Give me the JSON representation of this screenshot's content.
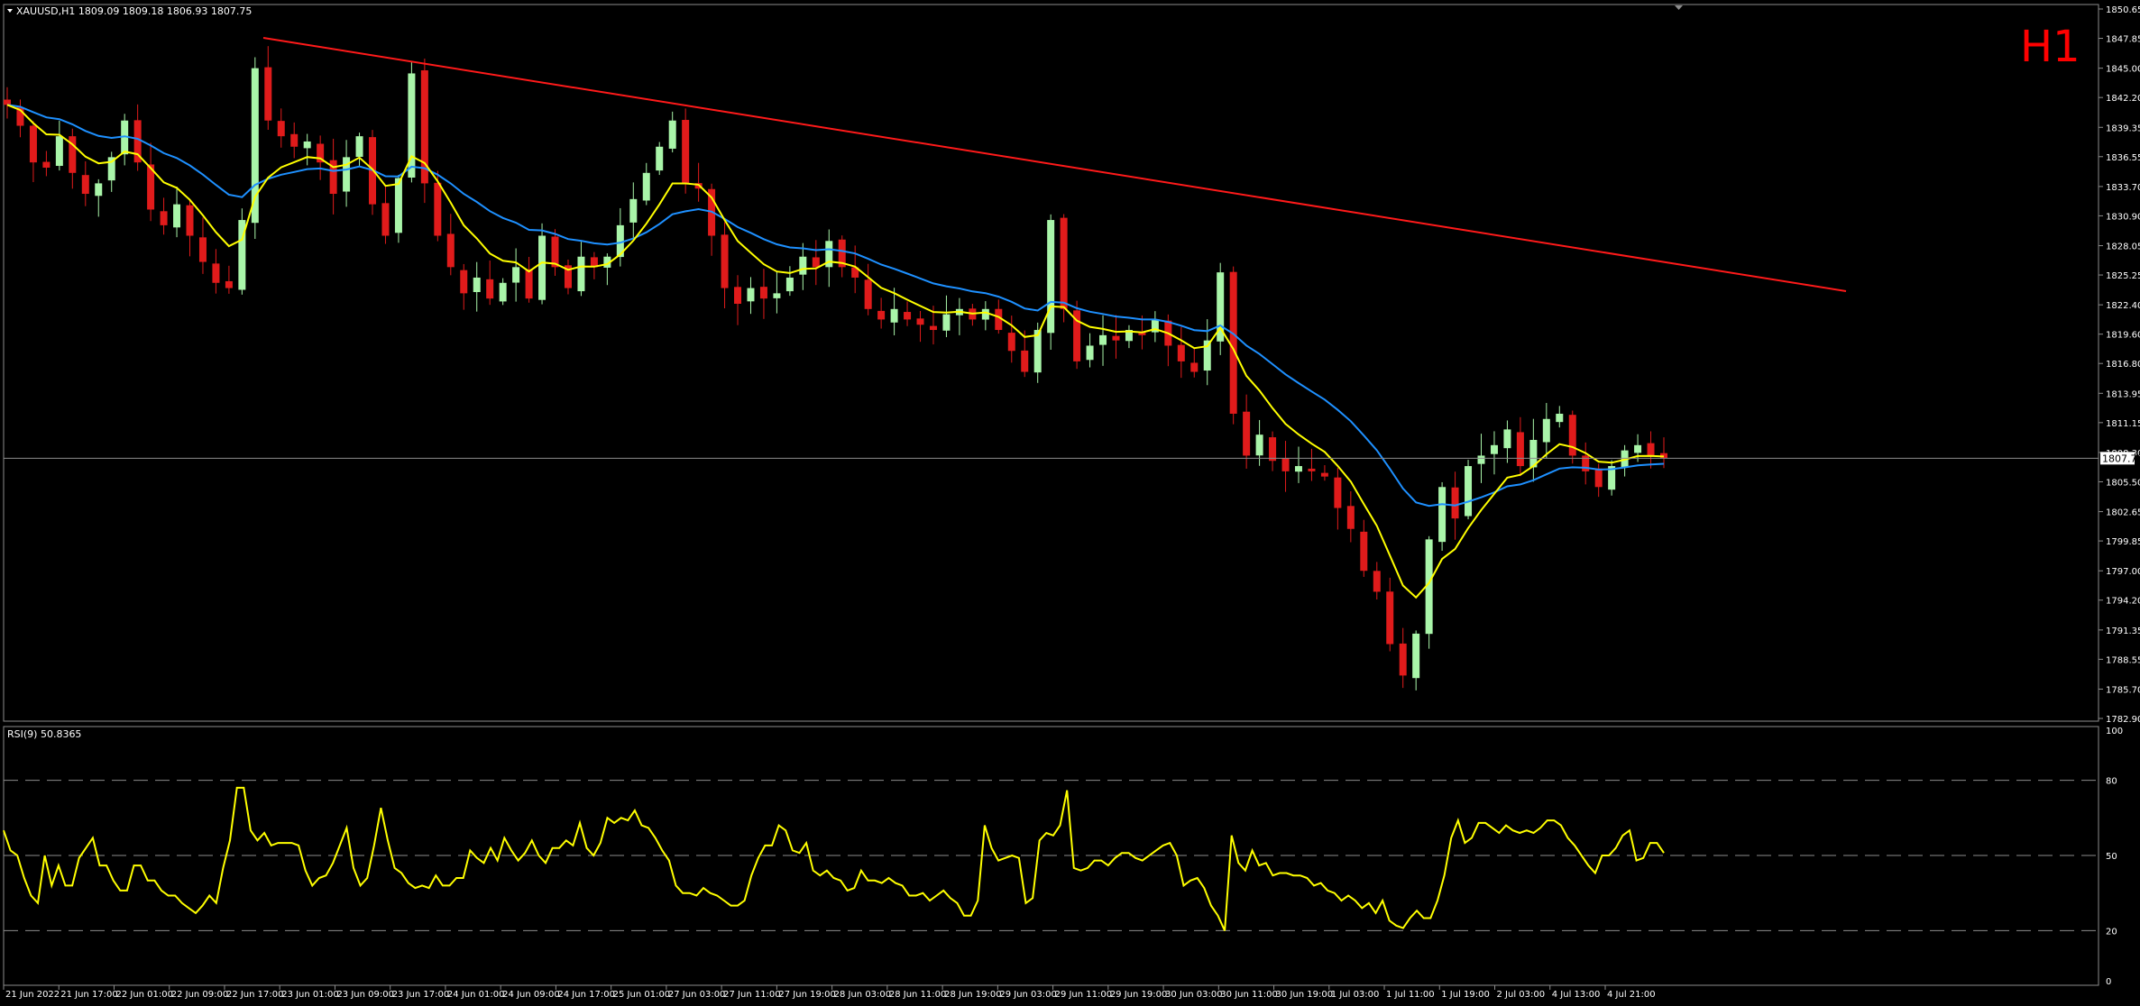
{
  "main": {
    "symbol_info": "XAUUSD,H1  1809.09 1809.18 1806.93 1807.75",
    "timeframe": "H1",
    "current_price": "1807.75",
    "current_price_value": 1807.75
  },
  "rsi": {
    "label": "RSI(9) 50.8365",
    "levels": [
      80,
      50,
      20
    ],
    "ticks": [
      "100",
      "80",
      "50",
      "20",
      "0"
    ]
  },
  "colors": {
    "background": "#000000",
    "bull": "#a9f5a9",
    "bear": "#e01b1b",
    "ma_fast": "#ffff00",
    "ma_slow": "#1e90ff",
    "trendline": "#ff1a1a",
    "rsi_line": "#ffff00",
    "timeframe_text": "#ff0000",
    "axis_text": "#ffffff"
  },
  "chart_data": [
    {
      "type": "candlestick",
      "symbol": "XAUUSD",
      "ylim": [
        1782.9,
        1850.65
      ],
      "y_ticks": [
        "1850.65",
        "1847.85",
        "1845.00",
        "1842.20",
        "1839.35",
        "1836.55",
        "1833.70",
        "1830.90",
        "1828.05",
        "1825.25",
        "1822.40",
        "1819.60",
        "1816.80",
        "1813.95",
        "1811.15",
        "1808.30",
        "1805.50",
        "1802.65",
        "1799.85",
        "1797.00",
        "1794.20",
        "1791.35",
        "1788.55",
        "1785.70",
        "1782.90"
      ],
      "x_labels": [
        "21 Jun 2022",
        "21 Jun 17:00",
        "22 Jun 01:00",
        "22 Jun 09:00",
        "22 Jun 17:00",
        "23 Jun 01:00",
        "23 Jun 09:00",
        "23 Jun 17:00",
        "24 Jun 01:00",
        "24 Jun 09:00",
        "24 Jun 17:00",
        "25 Jun 01:00",
        "27 Jun 03:00",
        "27 Jun 11:00",
        "27 Jun 19:00",
        "28 Jun 03:00",
        "28 Jun 11:00",
        "28 Jun 19:00",
        "29 Jun 03:00",
        "29 Jun 11:00",
        "29 Jun 19:00",
        "30 Jun 03:00",
        "30 Jun 11:00",
        "30 Jun 19:00",
        "1 Jul 03:00",
        "1 Jul 11:00",
        "1 Jul 19:00",
        "2 Jul 03:00",
        "4 Jul 13:00",
        "4 Jul 21:00"
      ],
      "close_path": [
        1841.5,
        1839.5,
        1836.0,
        1835.5,
        1838.5,
        1835.0,
        1833.0,
        1834.0,
        1836.5,
        1840.0,
        1836.0,
        1831.5,
        1830.0,
        1832.0,
        1829.0,
        1826.5,
        1824.5,
        1824.0,
        1830.5,
        1845.0,
        1840.0,
        1838.5,
        1837.5,
        1838.0,
        1836.0,
        1833.0,
        1836.5,
        1838.5,
        1832.0,
        1829.0,
        1834.5,
        1844.5,
        1834.0,
        1829.0,
        1826.0,
        1823.5,
        1825.0,
        1823.0,
        1824.5,
        1826.0,
        1823.0,
        1829.0,
        1826.0,
        1824.0,
        1827.0,
        1826.0,
        1827.0,
        1830.0,
        1832.5,
        1835.0,
        1837.5,
        1840.0,
        1834.0,
        1833.5,
        1829.0,
        1824.0,
        1822.5,
        1824.0,
        1823.0,
        1823.5,
        1825.0,
        1827.0,
        1826.0,
        1828.5,
        1826.0,
        1825.0,
        1822.0,
        1821.0,
        1822.0,
        1821.0,
        1820.5,
        1820.0,
        1821.5,
        1822.0,
        1821.0,
        1822.0,
        1820.0,
        1818.0,
        1816.0,
        1820.0,
        1830.5,
        1822.0,
        1817.0,
        1818.5,
        1819.5,
        1819.0,
        1820.0,
        1819.5,
        1821.0,
        1818.5,
        1817.0,
        1816.0,
        1819.0,
        1825.5,
        1812.0,
        1808.0,
        1810.0,
        1807.5,
        1806.5,
        1807.0,
        1806.5,
        1806.0,
        1803.0,
        1801.0,
        1797.0,
        1795.0,
        1790.0,
        1787.0,
        1791.0,
        1800.0,
        1805.0,
        1802.0,
        1807.0,
        1808.0,
        1809.0,
        1810.5,
        1807.0,
        1809.5,
        1811.5,
        1812.0,
        1808.0,
        1806.5,
        1805.0,
        1807.0,
        1808.5,
        1809.0,
        1808.0,
        1807.75
      ]
    },
    {
      "type": "line",
      "name": "RSI(9)",
      "ylim": [
        0,
        100
      ],
      "values": [
        60,
        52,
        50,
        41,
        34,
        31,
        50,
        38,
        46,
        38,
        38,
        49,
        53,
        57,
        46,
        46,
        40,
        36,
        36,
        46,
        46,
        40,
        40,
        36,
        34,
        34,
        31,
        29,
        27,
        30,
        34,
        31,
        45,
        56,
        77,
        77,
        60,
        56,
        59,
        54,
        55,
        55,
        55,
        54,
        44,
        38,
        41,
        42,
        47,
        54,
        61,
        45,
        38,
        41,
        54,
        69,
        56,
        45,
        43,
        39,
        37,
        38,
        37,
        42,
        38,
        38,
        41,
        41,
        52,
        49,
        47,
        53,
        48,
        57,
        52,
        48,
        51,
        56,
        50,
        47,
        53,
        53,
        56,
        54,
        63,
        53,
        50,
        55,
        65,
        63,
        65,
        64,
        68,
        62,
        61,
        57,
        52,
        48,
        38,
        35,
        35,
        34,
        37,
        35,
        34,
        32,
        30,
        30,
        32,
        42,
        49,
        54,
        54,
        62,
        60,
        52,
        51,
        55,
        44,
        42,
        44,
        41,
        40,
        36,
        37,
        44,
        40,
        40,
        39,
        41,
        39,
        38,
        34,
        34,
        35,
        32,
        34,
        36,
        33,
        31,
        26,
        26,
        32,
        62,
        53,
        48,
        49,
        50,
        49,
        31,
        33,
        56,
        59,
        58,
        62,
        76,
        45,
        44,
        45,
        48,
        48,
        46,
        49,
        51,
        51,
        49,
        48,
        50,
        52,
        54,
        55,
        50,
        38,
        40,
        41,
        37,
        30,
        26,
        20,
        58,
        47,
        44,
        52,
        46,
        47,
        42,
        43,
        43,
        42,
        42,
        41,
        38,
        39,
        36,
        35,
        32,
        34,
        32,
        29,
        31,
        27,
        32,
        24,
        22,
        21,
        25,
        28,
        25,
        25,
        32,
        42,
        57,
        64,
        55,
        57,
        63,
        63,
        61,
        59,
        62,
        60,
        59,
        60,
        59,
        61,
        64,
        64,
        62,
        57,
        54,
        50,
        46,
        43,
        50,
        50,
        53,
        58,
        60,
        48,
        49,
        55,
        55,
        51
      ]
    }
  ]
}
